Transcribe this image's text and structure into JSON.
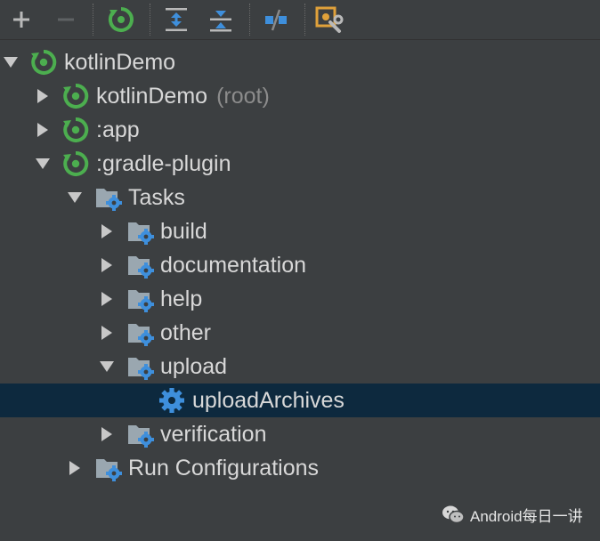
{
  "toolbar": {
    "buttons": [
      {
        "name": "add-button",
        "icon": "plus-icon"
      },
      {
        "name": "remove-button",
        "icon": "minus-icon"
      },
      {
        "name": "refresh-button",
        "icon": "gradle-refresh-icon"
      },
      {
        "name": "expand-all-button",
        "icon": "expand-all-icon"
      },
      {
        "name": "collapse-all-button",
        "icon": "collapse-all-icon"
      },
      {
        "name": "toggle-offline-button",
        "icon": "offline-toggle-icon"
      },
      {
        "name": "gradle-settings-button",
        "icon": "build-settings-icon"
      }
    ]
  },
  "tree": {
    "nodes": [
      {
        "label": "kotlinDemo",
        "suffix": "",
        "arrow": "down",
        "icon": "gradle-project-icon"
      },
      {
        "label": "kotlinDemo",
        "suffix": "(root)",
        "arrow": "right",
        "icon": "gradle-module-icon"
      },
      {
        "label": ":app",
        "suffix": "",
        "arrow": "right",
        "icon": "gradle-module-icon"
      },
      {
        "label": ":gradle-plugin",
        "suffix": "",
        "arrow": "down",
        "icon": "gradle-module-icon"
      },
      {
        "label": "Tasks",
        "suffix": "",
        "arrow": "down",
        "icon": "task-folder-icon"
      },
      {
        "label": "build",
        "suffix": "",
        "arrow": "right",
        "icon": "task-folder-icon"
      },
      {
        "label": "documentation",
        "suffix": "",
        "arrow": "right",
        "icon": "task-folder-icon"
      },
      {
        "label": "help",
        "suffix": "",
        "arrow": "right",
        "icon": "task-folder-icon"
      },
      {
        "label": "other",
        "suffix": "",
        "arrow": "right",
        "icon": "task-folder-icon"
      },
      {
        "label": "upload",
        "suffix": "",
        "arrow": "down",
        "icon": "task-folder-icon"
      },
      {
        "label": "uploadArchives",
        "suffix": "",
        "arrow": "none",
        "icon": "gear-icon",
        "selected": true
      },
      {
        "label": "verification",
        "suffix": "",
        "arrow": "right",
        "icon": "task-folder-icon"
      },
      {
        "label": "Run Configurations",
        "suffix": "",
        "arrow": "right",
        "icon": "task-folder-icon"
      }
    ]
  },
  "colors": {
    "background": "#3c3f41",
    "selection": "#0d293e",
    "gradle_green": "#4cae4f",
    "gear_blue": "#3e8fdc",
    "text": "#d8d8d8",
    "muted_text": "#8c8c8c"
  },
  "watermark": {
    "text": "Android每日一讲",
    "icon": "wechat-icon"
  }
}
